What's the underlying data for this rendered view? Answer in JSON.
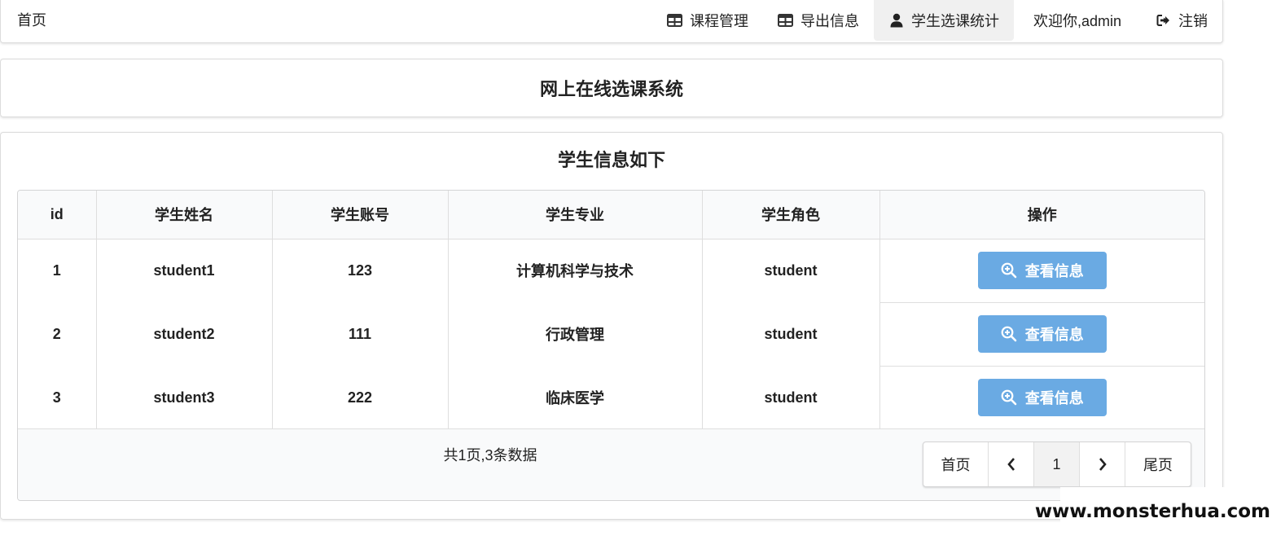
{
  "nav": {
    "home": "首页",
    "items": [
      {
        "label": "课程管理",
        "icon": "table-icon"
      },
      {
        "label": "导出信息",
        "icon": "table-icon"
      },
      {
        "label": "学生选课统计",
        "icon": "user-icon",
        "active": true
      }
    ],
    "welcome": "欢迎你,admin",
    "logout": "注销"
  },
  "system_title": "网上在线选课系统",
  "section_title": "学生信息如下",
  "table": {
    "headers": [
      "id",
      "学生姓名",
      "学生账号",
      "学生专业",
      "学生角色",
      "操作"
    ],
    "rows": [
      {
        "id": "1",
        "name": "student1",
        "account": "123",
        "major": "计算机科学与技术",
        "role": "student"
      },
      {
        "id": "2",
        "name": "student2",
        "account": "111",
        "major": "行政管理",
        "role": "student"
      },
      {
        "id": "3",
        "name": "student3",
        "account": "222",
        "major": "临床医学",
        "role": "student"
      }
    ],
    "action_label": "查看信息"
  },
  "pagination": {
    "summary": "共1页,3条数据",
    "first": "首页",
    "prev": "‹",
    "current": "1",
    "next": "›",
    "last": "尾页"
  },
  "watermark": "www.monsterhua.com",
  "colors": {
    "action_button": "#6aaae3"
  }
}
